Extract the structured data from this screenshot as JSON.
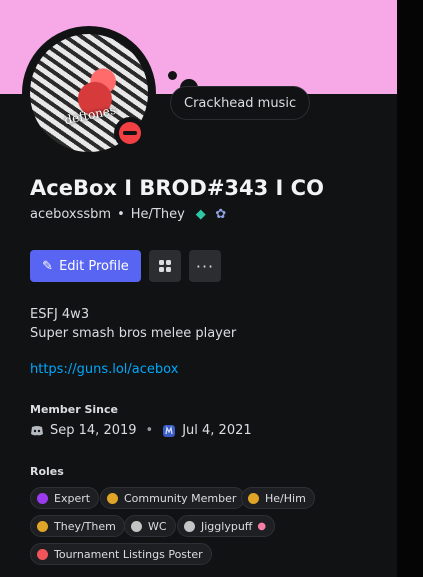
{
  "status_bubble": "Crackhead music",
  "avatar_text": "deftones",
  "profile": {
    "display_name": "AceBox I BROD#343 I CO",
    "username": "aceboxssbm",
    "separator": "•",
    "pronouns": "He/They"
  },
  "buttons": {
    "edit_profile": "Edit Profile",
    "group_icon": "group-icon",
    "more_icon": "more-icon",
    "more_glyph": "···"
  },
  "bio": {
    "line1": "ESFJ 4w3",
    "line2": "Super smash bros melee player",
    "link": "https://guns.lol/acebox"
  },
  "member_since": {
    "title": "Member Since",
    "discord_date": "Sep 14, 2019",
    "separator": "•",
    "server_date": "Jul 4, 2021"
  },
  "roles": {
    "title": "Roles",
    "items": [
      {
        "label": "Expert",
        "color": "#9b3bf0"
      },
      {
        "label": "Community Member",
        "color": "#e0a526"
      },
      {
        "label": "He/Him",
        "color": "#e0a526"
      },
      {
        "label": "They/Them",
        "color": "#e0a526"
      },
      {
        "label": "WC",
        "color": "#c4c4c4"
      },
      {
        "label": "Jigglypuff",
        "color": "#c4c4c4"
      },
      {
        "label": "Tournament Listings Poster",
        "color": "#f0555b"
      }
    ]
  },
  "colors": {
    "banner": "#f7a8e6",
    "accent": "#5865f2",
    "link": "#00a8fc",
    "dnd": "#f23f43"
  }
}
